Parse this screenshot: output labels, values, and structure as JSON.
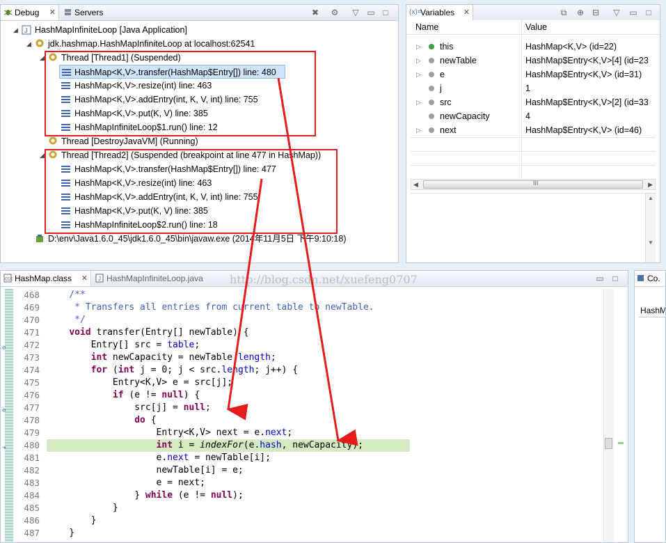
{
  "debug_view": {
    "tab_debug": "Debug",
    "tab_servers": "Servers",
    "items": [
      {
        "label": "HashMapInfiniteLoop [Java Application]"
      },
      {
        "label": "jdk.hashmap.HashMapInfiniteLoop at localhost:62541"
      },
      {
        "label": "Thread [Thread1] (Suspended)"
      },
      {
        "label": "HashMap<K,V>.transfer(HashMap$Entry[]) line: 480"
      },
      {
        "label": "HashMap<K,V>.resize(int) line: 463"
      },
      {
        "label": "HashMap<K,V>.addEntry(int, K, V, int) line: 755"
      },
      {
        "label": "HashMap<K,V>.put(K, V) line: 385"
      },
      {
        "label": "HashMapInfiniteLoop$1.run() line: 12"
      },
      {
        "label": "Thread [DestroyJavaVM] (Running)"
      },
      {
        "label": "Thread [Thread2] (Suspended (breakpoint at line 477 in HashMap))"
      },
      {
        "label": "HashMap<K,V>.transfer(HashMap$Entry[]) line: 477"
      },
      {
        "label": "HashMap<K,V>.resize(int) line: 463"
      },
      {
        "label": "HashMap<K,V>.addEntry(int, K, V, int) line: 755"
      },
      {
        "label": "HashMap<K,V>.put(K, V) line: 385"
      },
      {
        "label": "HashMapInfiniteLoop$2.run() line: 18"
      },
      {
        "label": "D:\\env\\Java1.6.0_45\\jdk1.6.0_45\\bin\\javaw.exe (2014年11月5日 下午9:10:18)"
      }
    ]
  },
  "variables_view": {
    "tab": "Variables",
    "col_name": "Name",
    "col_value": "Value",
    "rows": [
      {
        "name": "this",
        "value": "HashMap<K,V>  (id=22)"
      },
      {
        "name": "newTable",
        "value": "HashMap$Entry<K,V>[4]  (id=23"
      },
      {
        "name": "e",
        "value": "HashMap$Entry<K,V>  (id=31)"
      },
      {
        "name": "j",
        "value": "1"
      },
      {
        "name": "src",
        "value": "HashMap$Entry<K,V>[2]  (id=33"
      },
      {
        "name": "newCapacity",
        "value": "4"
      },
      {
        "name": "next",
        "value": "HashMap$Entry<K,V>  (id=46)"
      }
    ]
  },
  "editor": {
    "tab_active": "HashMap.class",
    "tab_inactive": "HashMapInfiniteLoop.java",
    "watermark": "http://blog.csdn.net/xuefeng0707",
    "line_numbers": [
      "468",
      "469",
      "470",
      "471",
      "472",
      "473",
      "474",
      "475",
      "476",
      "477",
      "478",
      "479",
      "480",
      "481",
      "482",
      "483",
      "484",
      "485",
      "486",
      "487"
    ]
  },
  "outline_view": {
    "tab": "Co.",
    "item": "HashM"
  },
  "colors": {
    "annotation_red": "#e31b1b",
    "current_line": "#d4eac1",
    "keyword": "#7f0055",
    "comment": "#3f5fbf",
    "field": "#0000c0"
  }
}
